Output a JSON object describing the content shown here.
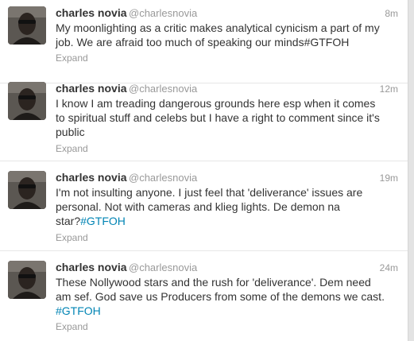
{
  "tweets": [
    {
      "name": "charles novia",
      "handle": "@charlesnovia",
      "time": "8m",
      "text_lines": [
        "My moonlighting as a critic makes analytical cynicism a part of my",
        "job. We are afraid too much of speaking our minds#GTFOH"
      ],
      "hashtag": "",
      "expand": "Expand"
    },
    {
      "name": "charles novia",
      "handle": "@charlesnovia",
      "time": "12m",
      "text_lines": [
        "I know I am treading dangerous grounds here esp when it comes",
        "to spiritual stuff and celebs but I have a right to comment since it's",
        "public"
      ],
      "hashtag": "",
      "expand": "Expand"
    },
    {
      "name": "charles novia",
      "handle": "@charlesnovia",
      "time": "19m",
      "text_lines": [
        "I'm not insulting anyone. I just feel that 'deliverance' issues are",
        "personal. Not with cameras and klieg lights. De demon na",
        "star?"
      ],
      "hashtag": "#GTFOH",
      "expand": "Expand"
    },
    {
      "name": "charles novia",
      "handle": "@charlesnovia",
      "time": "24m",
      "text_lines": [
        "These Nollywood stars and the rush for 'deliverance'. Dem need",
        "am sef. God save us Producers from some of the demons we cast.",
        ""
      ],
      "hashtag": "#GTFOH",
      "expand": "Expand"
    }
  ]
}
